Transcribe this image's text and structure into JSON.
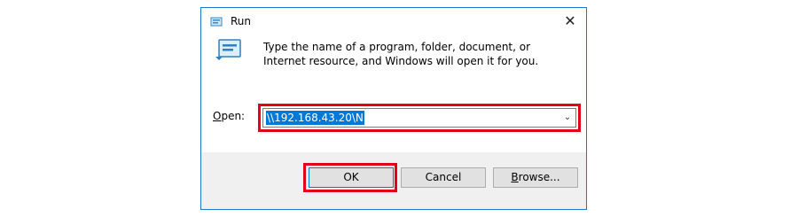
{
  "dialog": {
    "title": "Run",
    "close_glyph": "✕",
    "title_icon": "run-icon",
    "description": "Type the name of a program, folder, document, or Internet resource, and Windows will open it for you.",
    "open_label_underlined": "O",
    "open_label_rest": "pen:",
    "open_value": "\\\\192.168.43.20\\N",
    "buttons": {
      "ok": "OK",
      "cancel": "Cancel",
      "browse_underlined": "B",
      "browse_rest": "rowse..."
    }
  },
  "colors": {
    "highlight": "#e3001b",
    "selection": "#0078d7",
    "footer_bg": "#f0f0f0",
    "border": "#1979ca"
  }
}
